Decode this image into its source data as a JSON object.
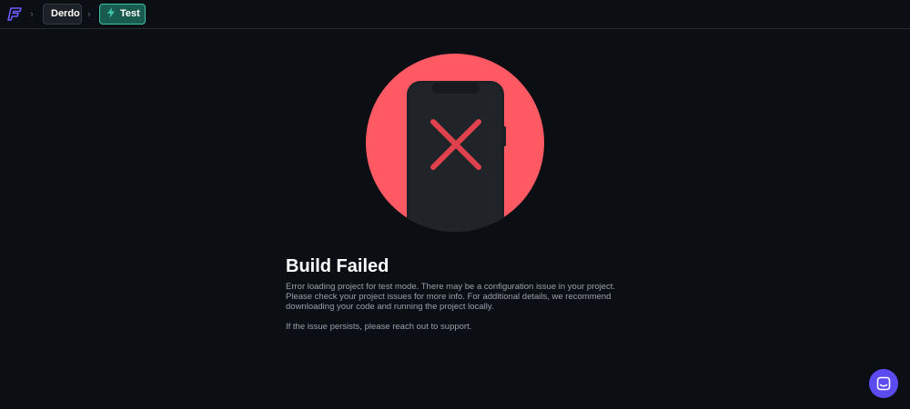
{
  "breadcrumb": {
    "project_label": "Derdo",
    "mode_label": "Test"
  },
  "error": {
    "title": "Build Failed",
    "message": "Error loading project for test mode. There may be a configuration issue in your project. Please check your project issues for more info. For additional details, we recommend downloading your code and running the project locally.",
    "support_message": "If the issue persists, please reach out to support."
  },
  "icons": {
    "logo": "flutterflow-logo-icon",
    "separator": "chevron-right-icon",
    "mode": "bolt-icon",
    "illustration": "phone-error-icon",
    "chat": "chat-icon"
  },
  "colors": {
    "background": "#0b0e12",
    "accent_test": "#3ec2a8",
    "error_circle": "#ff5a64",
    "error_x": "#e0424d",
    "chat_button": "#5b4bf0"
  }
}
